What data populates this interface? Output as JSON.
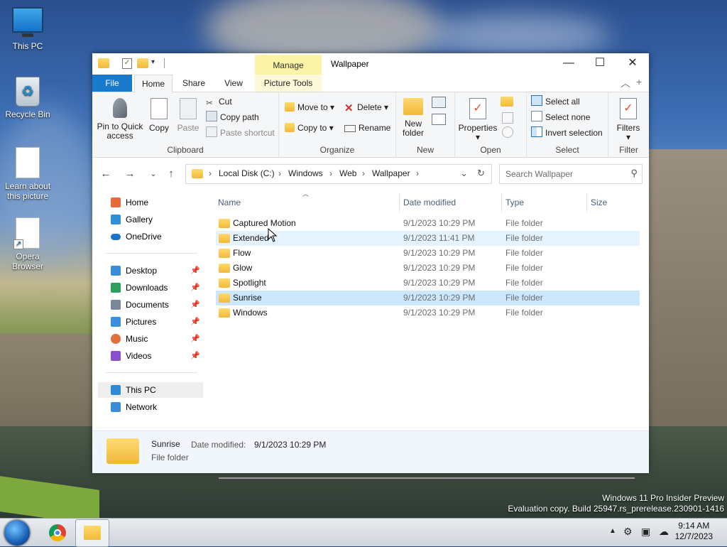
{
  "desktop": {
    "icons": [
      {
        "label": "This PC"
      },
      {
        "label": "Recycle Bin"
      },
      {
        "label": "Learn about this picture"
      },
      {
        "label": "Opera Browser"
      }
    ],
    "watermark_line1": "Windows 11 Pro Insider Preview",
    "watermark_line2": "Evaluation copy. Build 25947.rs_prerelease.230901-1416"
  },
  "window": {
    "title": "Wallpaper",
    "manage_label": "Manage",
    "tabs": [
      "File",
      "Home",
      "Share",
      "View",
      "Picture Tools"
    ],
    "ribbon": {
      "clipboard": {
        "label": "Clipboard",
        "pin": "Pin to Quick access",
        "copy": "Copy",
        "paste": "Paste",
        "cut": "Cut",
        "copy_path": "Copy path",
        "paste_shortcut": "Paste shortcut"
      },
      "organize": {
        "label": "Organize",
        "move_to": "Move to",
        "copy_to": "Copy to",
        "delete": "Delete",
        "rename": "Rename"
      },
      "new": {
        "label": "New",
        "new_folder": "New folder"
      },
      "open": {
        "label": "Open",
        "properties": "Properties"
      },
      "select": {
        "label": "Select",
        "select_all": "Select all",
        "select_none": "Select none",
        "invert": "Invert selection"
      },
      "filter": {
        "label": "Filter",
        "filters": "Filters"
      }
    },
    "address": {
      "parts": [
        "Local Disk (C:)",
        "Windows",
        "Web",
        "Wallpaper"
      ]
    },
    "search": {
      "placeholder": "Search Wallpaper"
    },
    "nav": {
      "top": [
        {
          "label": "Home",
          "color": "#e86a3a"
        },
        {
          "label": "Gallery",
          "color": "#2f8fd8"
        },
        {
          "label": "OneDrive",
          "color": "#1a73c8"
        }
      ],
      "pinned": [
        {
          "label": "Desktop",
          "color": "#3a8ed8"
        },
        {
          "label": "Downloads",
          "color": "#2e9f5c"
        },
        {
          "label": "Documents",
          "color": "#7a8796"
        },
        {
          "label": "Pictures",
          "color": "#3b8fe0"
        },
        {
          "label": "Music",
          "color": "#e0703c"
        },
        {
          "label": "Videos",
          "color": "#8a4fcf"
        }
      ],
      "bottom": [
        {
          "label": "This PC",
          "color": "#2e8ad6"
        },
        {
          "label": "Network",
          "color": "#3a8ed8"
        }
      ]
    },
    "columns": {
      "name": "Name",
      "date": "Date modified",
      "type": "Type",
      "size": "Size"
    },
    "files": [
      {
        "name": "Captured Motion",
        "date": "9/1/2023 10:29 PM",
        "type": "File folder"
      },
      {
        "name": "Extended",
        "date": "9/1/2023 11:41 PM",
        "type": "File folder"
      },
      {
        "name": "Flow",
        "date": "9/1/2023 10:29 PM",
        "type": "File folder"
      },
      {
        "name": "Glow",
        "date": "9/1/2023 10:29 PM",
        "type": "File folder"
      },
      {
        "name": "Spotlight",
        "date": "9/1/2023 10:29 PM",
        "type": "File folder"
      },
      {
        "name": "Sunrise",
        "date": "9/1/2023 10:29 PM",
        "type": "File folder"
      },
      {
        "name": "Windows",
        "date": "9/1/2023 10:29 PM",
        "type": "File folder"
      }
    ],
    "details": {
      "name": "Sunrise",
      "modified_label": "Date modified:",
      "modified_value": "9/1/2023 10:29 PM",
      "type": "File folder"
    }
  },
  "taskbar": {
    "time": "9:14 AM",
    "date": "12/7/2023"
  },
  "colors": {
    "accent": "#1979ca",
    "selection": "#cce8ff",
    "manage": "#fbf3a6"
  }
}
